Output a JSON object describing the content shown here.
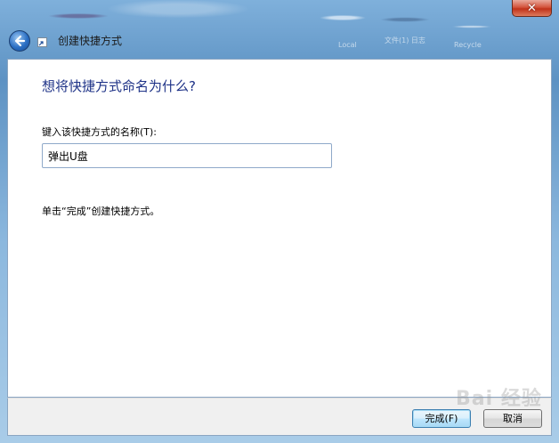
{
  "window": {
    "title": "创建快捷方式",
    "close_symbol": "✕"
  },
  "background_text": [
    "Local",
    "文件(1) 日志",
    "Recycle"
  ],
  "dialog": {
    "heading": "想将快捷方式命名为什么?",
    "name_label": "键入该快捷方式的名称(T):",
    "name_value": "弹出U盘",
    "hint": "单击“完成”创建快捷方式。"
  },
  "buttons": {
    "finish": "完成(F)",
    "cancel": "取消"
  },
  "watermark": "Bai 经验"
}
